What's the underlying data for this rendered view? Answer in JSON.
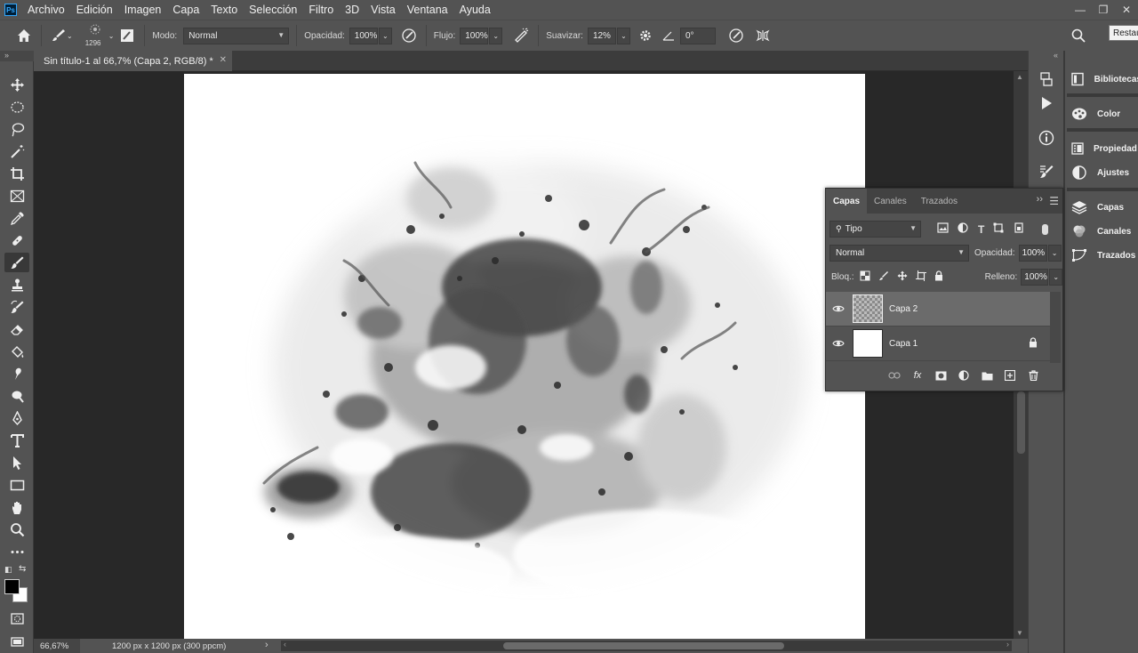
{
  "app": {
    "logo": "Ps",
    "menu": [
      "Archivo",
      "Edición",
      "Imagen",
      "Capa",
      "Texto",
      "Selección",
      "Filtro",
      "3D",
      "Vista",
      "Ventana",
      "Ayuda"
    ],
    "restore_tooltip": "Restau"
  },
  "options_bar": {
    "brush_size": "1296",
    "mode_label": "Modo:",
    "mode_value": "Normal",
    "opacity_label": "Opacidad:",
    "opacity_value": "100%",
    "flow_label": "Flujo:",
    "flow_value": "100%",
    "smoothing_label": "Suavizar:",
    "smoothing_value": "12%",
    "angle_value": "0°"
  },
  "document": {
    "tab_title": "Sin título-1 al 66,7% (Capa 2, RGB/8) *",
    "zoom": "66,67%",
    "doc_info": "1200 px x 1200 px (300 ppcm)"
  },
  "toolbar": {
    "tools": [
      "move-tool",
      "ellipse-marquee-tool",
      "lasso-tool",
      "magic-wand-tool",
      "crop-tool",
      "frame-tool",
      "eyedropper-tool",
      "healing-brush-tool",
      "brush-tool",
      "clone-stamp-tool",
      "history-brush-tool",
      "eraser-tool",
      "paint-bucket-tool",
      "smudge-tool",
      "dodge-tool",
      "pen-tool",
      "type-tool",
      "path-selection-tool",
      "rectangle-tool",
      "hand-tool",
      "zoom-tool",
      "more-tools"
    ],
    "active_tool": "brush-tool",
    "foreground_color": "#000000",
    "background_color": "#ffffff"
  },
  "right_dock": {
    "group1": [
      "Bibliotecas"
    ],
    "group2": [
      "Color"
    ],
    "group3": [
      "Propiedad…",
      "Ajustes"
    ],
    "group4": [
      "Capas",
      "Canales",
      "Trazados"
    ]
  },
  "layers_panel": {
    "tabs": [
      "Capas",
      "Canales",
      "Trazados"
    ],
    "active_tab": "Capas",
    "filter_label": "Tipo",
    "blend_mode": "Normal",
    "opacity_label": "Opacidad:",
    "opacity_value": "100%",
    "lock_label": "Bloq.:",
    "fill_label": "Relleno:",
    "fill_value": "100%",
    "layers": [
      {
        "name": "Capa 2",
        "selected": true,
        "locked": false
      },
      {
        "name": "Capa 1",
        "selected": false,
        "locked": true
      }
    ]
  },
  "colors": {
    "ui_panel": "#535353",
    "ui_dark": "#282828",
    "selected_layer": "#6b6b6b",
    "accent_logo": "#31a8ff"
  }
}
